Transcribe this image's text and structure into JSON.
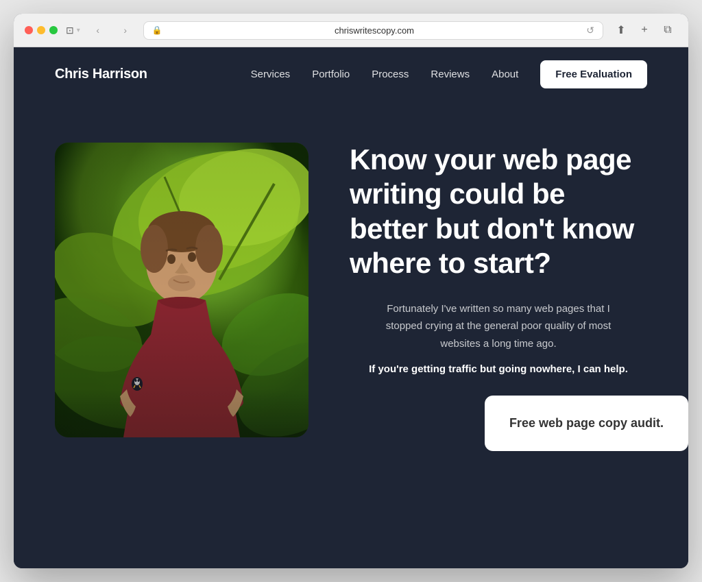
{
  "browser": {
    "url": "chriswritescopy.com",
    "back_label": "‹",
    "forward_label": "›"
  },
  "nav": {
    "logo": "Chris Harrison",
    "links": [
      {
        "label": "Services",
        "href": "#"
      },
      {
        "label": "Portfolio",
        "href": "#"
      },
      {
        "label": "Process",
        "href": "#"
      },
      {
        "label": "Reviews",
        "href": "#"
      },
      {
        "label": "About",
        "href": "#"
      }
    ],
    "cta": "Free Evaluation"
  },
  "hero": {
    "headline": "Know your web page writing could be better but don't know where to start?",
    "subtext": "Fortunately I've written so many web pages that I stopped crying at the general poor quality of most websites a long time ago.",
    "bold_text": "If you're getting traffic but going nowhere, I can help.",
    "cta_card_text": "Free web page copy audit."
  }
}
